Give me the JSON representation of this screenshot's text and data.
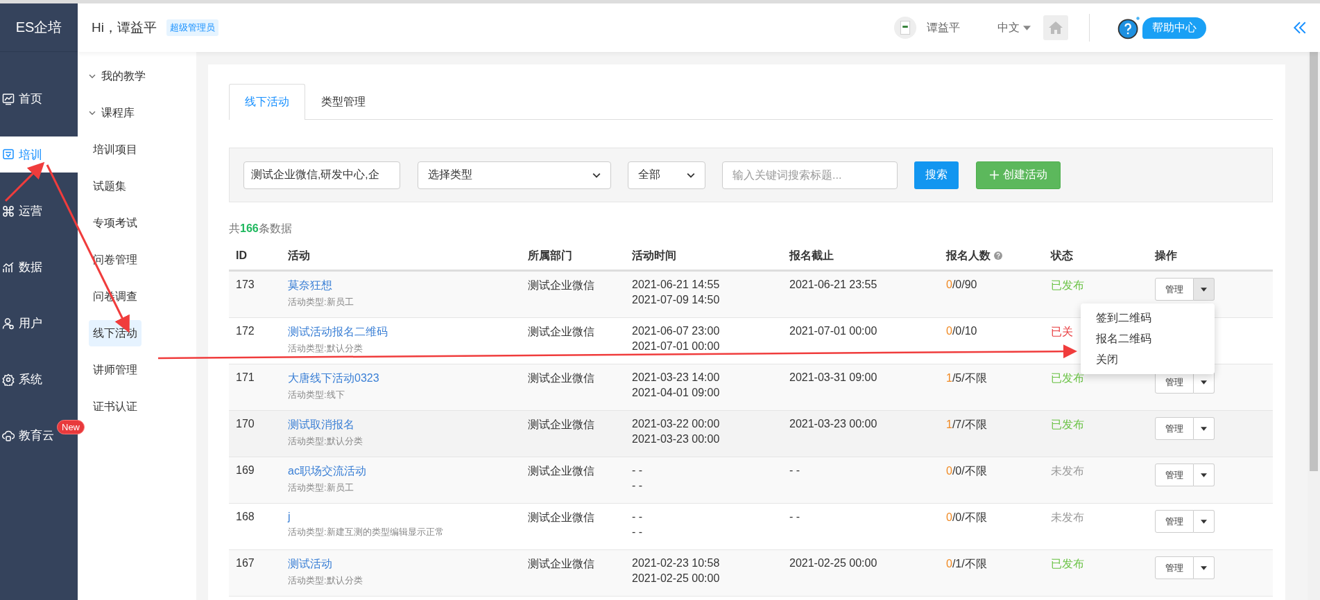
{
  "sidebar": {
    "logo": "ES企培",
    "items": [
      {
        "label": "首页",
        "selected": false
      },
      {
        "label": "培训",
        "selected": true
      },
      {
        "label": "运营",
        "selected": false
      },
      {
        "label": "数据",
        "selected": false
      },
      {
        "label": "用户",
        "selected": false
      },
      {
        "label": "系统",
        "selected": false
      },
      {
        "label": "教育云",
        "selected": false,
        "badge": "New"
      }
    ]
  },
  "header": {
    "greeting": "Hi，谭益平",
    "role": "超级管理员",
    "user_name": "谭益平",
    "language": "中文",
    "help": "帮助中心"
  },
  "subnav": {
    "items": [
      {
        "kind": "group",
        "label": "我的教学",
        "expanded": true
      },
      {
        "kind": "group",
        "label": "课程库",
        "expanded": true
      },
      {
        "kind": "link",
        "label": "培训项目",
        "selected": false
      },
      {
        "kind": "link",
        "label": "试题集",
        "selected": false
      },
      {
        "kind": "link",
        "label": "专项考试",
        "selected": false
      },
      {
        "kind": "link",
        "label": "问卷管理",
        "selected": false
      },
      {
        "kind": "link",
        "label": "问卷调查",
        "selected": false
      },
      {
        "kind": "link",
        "label": "线下活动",
        "selected": true
      },
      {
        "kind": "link",
        "label": "讲师管理",
        "selected": false
      },
      {
        "kind": "link",
        "label": "证书认证",
        "selected": false
      }
    ]
  },
  "tabs": [
    {
      "label": "线下活动",
      "selected": true
    },
    {
      "label": "类型管理",
      "selected": false
    }
  ],
  "filters": {
    "department": "测试企业微信,研发中心,企",
    "type_select": "选择类型",
    "status_select": "全部",
    "keyword": {
      "placeholder": "输入关键词搜索标题..."
    },
    "search_button": "搜索",
    "create_button": "创建活动"
  },
  "count": "共**166**条数据",
  "table": {
    "columns": [
      {
        "label": "ID"
      },
      {
        "label": "活动"
      },
      {
        "label": "所属部门"
      },
      {
        "label": "活动时间"
      },
      {
        "label": "报名截止"
      },
      {
        "label": "报名人数",
        "info_icon": true
      },
      {
        "label": "状态"
      },
      {
        "label": "操作"
      }
    ],
    "rows": [
      {
        "id": "173",
        "title": "莫奈狂想",
        "type": "活动类型:新员工",
        "dept": "测试企业微信",
        "time_start": "2021-06-21 14:55",
        "time_end": "2021-07-09 14:50",
        "deadline": "2021-06-21 23:55",
        "signups_first": "0",
        "signups_rest": "/0/90",
        "status": "已发布",
        "color": "#6ac245",
        "hovered": false,
        "manage": "管理",
        "has_manage": true,
        "menu_open": true
      },
      {
        "id": "172",
        "title": "测试活动报名二维码",
        "type": "活动类型:默认分类",
        "dept": "测试企业微信",
        "time_start": "2021-06-07 23:00",
        "time_end": "2021-07-01 00:00",
        "deadline": "2021-07-01 00:00",
        "signups_first": "0",
        "signups_rest": "/0/10",
        "status": "已关",
        "color": "#e8393c",
        "hovered": false,
        "has_manage": false
      },
      {
        "id": "171",
        "title": "大唐线下活动0323",
        "type": "活动类型:线下",
        "dept": "测试企业微信",
        "time_start": "2021-03-23 14:00",
        "time_end": "2021-04-01 09:00",
        "deadline": "2021-03-31 09:00",
        "signups_first": "1",
        "signups_rest": "/5/不限",
        "status": "已发布",
        "color": "#6ac245",
        "hovered": false,
        "manage": "管理",
        "has_manage": true,
        "menu_open": false
      },
      {
        "id": "170",
        "title": "测试取消报名",
        "type": "活动类型:默认分类",
        "dept": "测试企业微信",
        "time_start": "2021-03-22 00:00",
        "time_end": "2021-03-23 00:00",
        "deadline": "2021-03-23 00:00",
        "signups_first": "1",
        "signups_rest": "/7/不限",
        "status": "已发布",
        "color": "#6ac245",
        "hovered": true,
        "manage": "管理",
        "has_manage": true,
        "menu_open": false
      },
      {
        "id": "169",
        "title": "ac职场交流活动",
        "type": "活动类型:新员工",
        "dept": "测试企业微信",
        "time_start": "- -",
        "time_end": "- -",
        "deadline": "- -",
        "signups_first": "0",
        "signups_rest": "/0/不限",
        "status": "未发布",
        "color": "#999999",
        "hovered": false,
        "manage": "管理",
        "has_manage": true,
        "menu_open": false
      },
      {
        "id": "168",
        "title": "j",
        "type": "活动类型:新建互测的类型编辑显示正常",
        "dept": "测试企业微信",
        "time_start": "- -",
        "time_end": "- -",
        "deadline": "- -",
        "signups_first": "0",
        "signups_rest": "/0/不限",
        "status": "未发布",
        "color": "#999999",
        "hovered": false,
        "manage": "管理",
        "has_manage": true,
        "menu_open": false
      },
      {
        "id": "167",
        "title": "测试活动",
        "type": "活动类型:默认分类",
        "dept": "测试企业微信",
        "time_start": "2021-02-23 10:58",
        "time_end": "2021-02-25 00:00",
        "deadline": "2021-02-25 00:00",
        "signups_first": "0",
        "signups_rest": "/1/不限",
        "status": "已发布",
        "color": "#6ac245",
        "hovered": false,
        "manage": "管理",
        "has_manage": true,
        "menu_open": false
      }
    ]
  },
  "action_menu": {
    "items": [
      {
        "label": "签到二维码"
      },
      {
        "label": "报名二维码"
      },
      {
        "label": "关闭"
      }
    ]
  }
}
